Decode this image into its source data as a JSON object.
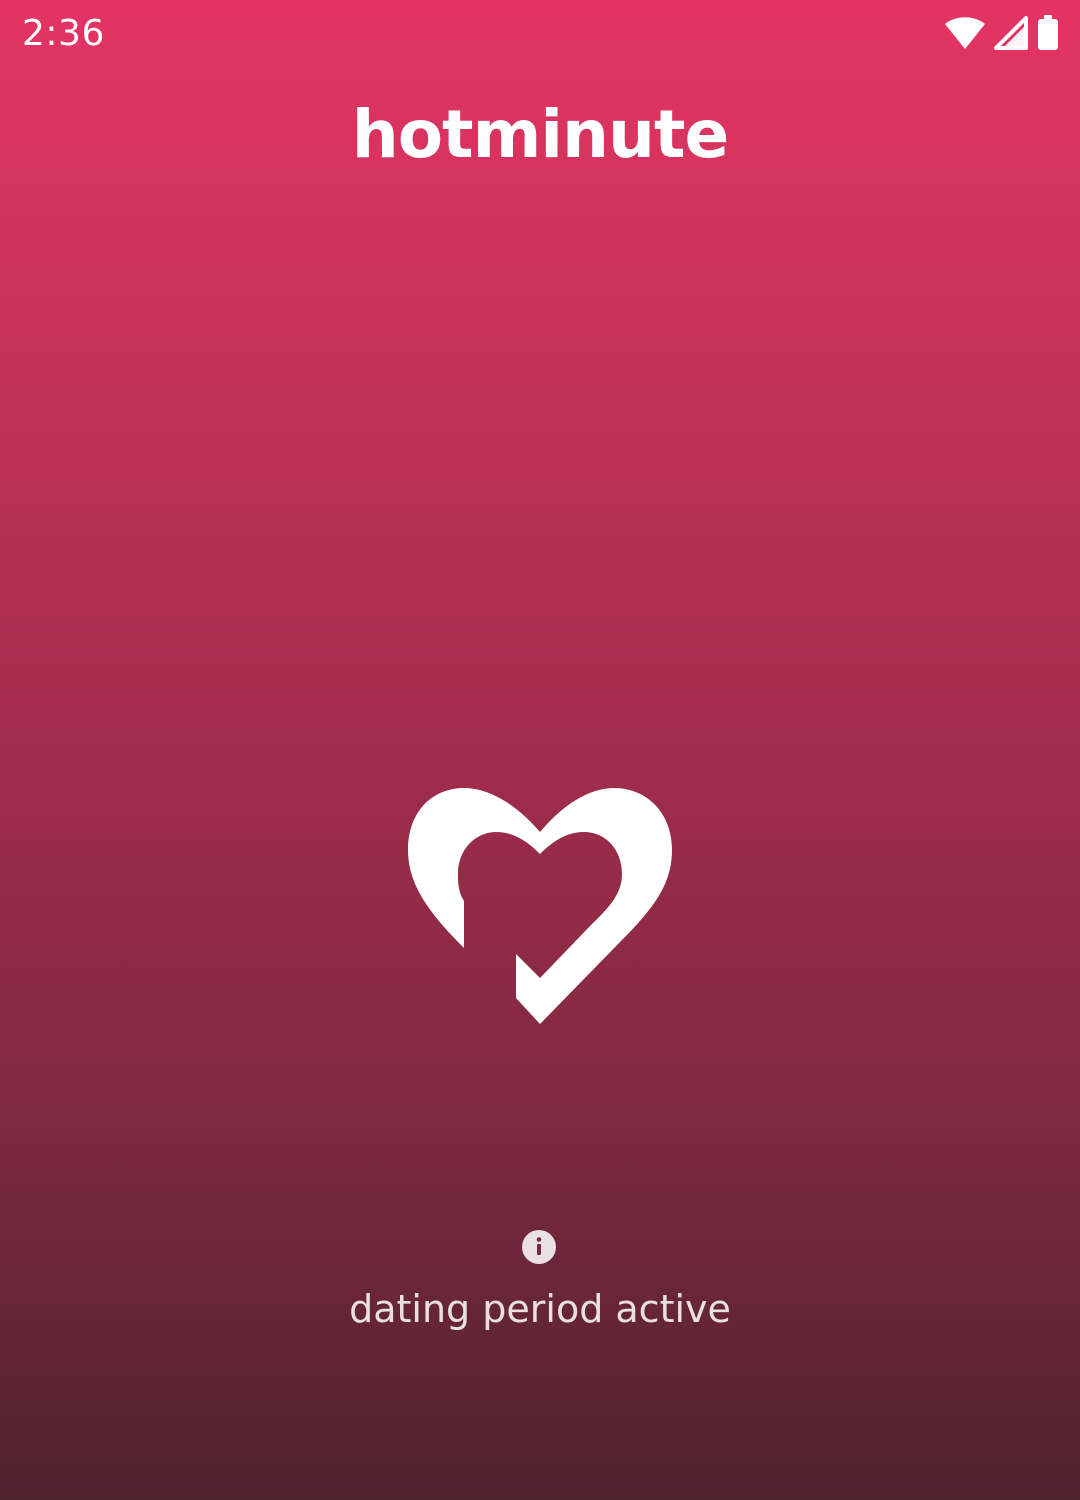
{
  "status_bar": {
    "time": "2:36",
    "icons": [
      "wifi-icon",
      "cellular-signal-icon",
      "battery-icon"
    ]
  },
  "app": {
    "title": "hotminute"
  },
  "logo": {
    "icon": "heart-check-logo"
  },
  "status": {
    "icon": "info-icon",
    "text": "dating period active"
  },
  "colors": {
    "gradient_top": "#e43464",
    "gradient_bottom": "#4f2230",
    "text": "#ffffff"
  }
}
